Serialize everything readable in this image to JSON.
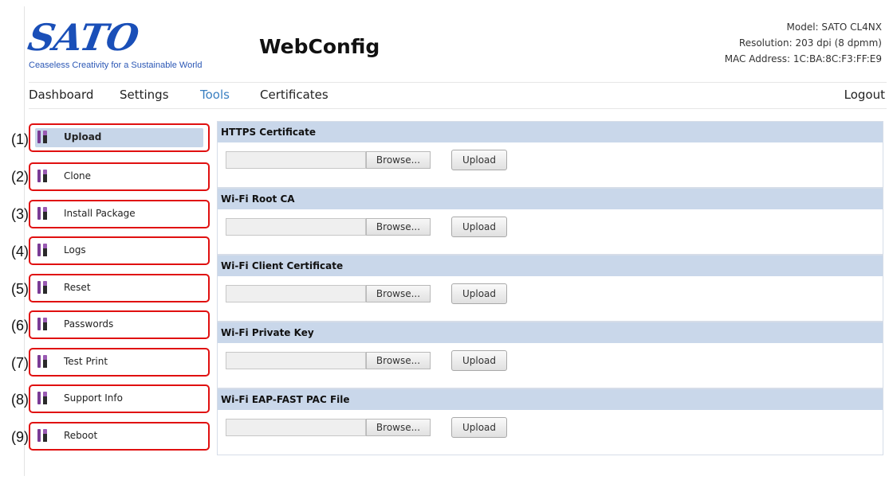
{
  "header": {
    "logo_text": "SATO",
    "tagline": "Ceaseless Creativity for a Sustainable World",
    "app_title": "WebConfig",
    "model": "Model: SATO CL4NX",
    "resolution": "Resolution: 203 dpi (8 dpmm)",
    "mac": "MAC Address: 1C:BA:8C:F3:FF:E9"
  },
  "nav": {
    "dashboard": "Dashboard",
    "settings": "Settings",
    "tools": "Tools",
    "certificates": "Certificates",
    "logout": "Logout"
  },
  "colors": {
    "accent_selected": "#c7d6e9",
    "highlight_border": "#e01010",
    "nav_active": "#3a7fc1",
    "icon_purple": "#7a3c96"
  },
  "sidebar": {
    "items": [
      {
        "label": "Upload",
        "annot": "(1)",
        "icon": "tools-icon"
      },
      {
        "label": "Clone",
        "annot": "(2)",
        "icon": "tools-icon"
      },
      {
        "label": "Install Package",
        "annot": "(3)",
        "icon": "tools-icon"
      },
      {
        "label": "Logs",
        "annot": "(4)",
        "icon": "tools-icon"
      },
      {
        "label": "Reset",
        "annot": "(5)",
        "icon": "tools-icon"
      },
      {
        "label": "Passwords",
        "annot": "(6)",
        "icon": "tools-icon"
      },
      {
        "label": "Test Print",
        "annot": "(7)",
        "icon": "tools-icon"
      },
      {
        "label": "Support Info",
        "annot": "(8)",
        "icon": "tools-icon"
      },
      {
        "label": "Reboot",
        "annot": "(9)",
        "icon": "tools-icon"
      }
    ]
  },
  "panels": [
    {
      "title": "HTTPS Certificate",
      "browse": "Browse...",
      "upload": "Upload"
    },
    {
      "title": "Wi-Fi Root CA",
      "browse": "Browse...",
      "upload": "Upload"
    },
    {
      "title": "Wi-Fi Client Certificate",
      "browse": "Browse...",
      "upload": "Upload"
    },
    {
      "title": "Wi-Fi Private Key",
      "browse": "Browse...",
      "upload": "Upload"
    },
    {
      "title": "Wi-Fi EAP-FAST PAC File",
      "browse": "Browse...",
      "upload": "Upload"
    }
  ]
}
